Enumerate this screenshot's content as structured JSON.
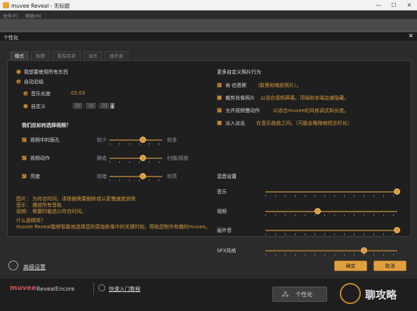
{
  "window": {
    "title": "muvee Reveal - 无标题",
    "min": "—",
    "max": "☐",
    "close": "✕"
  },
  "menu": [
    "文件(F)",
    "帮助(H)"
  ],
  "dialog": {
    "title": "个性化",
    "close": "✕"
  },
  "tabs": [
    "模式",
    "标题",
    "影院名单",
    "音乐",
    "画外音"
  ],
  "mode": {
    "option_random": "我想要使用所有东西",
    "option_auto": "自动总结",
    "music_length_label": "音乐长度",
    "music_length_value": "02:03",
    "custom_label": "自定义",
    "custom_h": "00",
    "custom_m": "00",
    "custom_s": "00",
    "sep1": ":",
    "sep2": ":"
  },
  "selection": {
    "heading": "我们应如何选择视频？",
    "rows": [
      {
        "label": "视频中的面孔",
        "left": "较少",
        "right": "较多",
        "level": 0.62
      },
      {
        "label": "视频动作",
        "left": "静态",
        "right": "扫描/摇放",
        "level": 0.62
      },
      {
        "label": "亮度",
        "left": "较暗",
        "right": "较亮",
        "level": 0.62
      }
    ]
  },
  "notes": {
    "lines": [
      [
        "图片：",
        "为符合时间，请根据需要删除或以更慢速度放映"
      ],
      [
        "音乐：",
        "播放所有音轨"
      ],
      [
        "视频：",
        "需要时截选以符合时间。"
      ]
    ],
    "what_title": "什么是精简？",
    "what_body": "muvee Reveal能够智能地选择您的原始影像中的关键时刻，帮助您制作有趣的muvee。"
  },
  "custom_photos": {
    "heading": "更多自定义照片行为",
    "items": [
      {
        "label": "肯·伯恩斯",
        "desc": "（取景和缩放照片）。"
      },
      {
        "label": "裁剪肖像照片",
        "desc": "以适合视频屏幕。顶端和末端会被隐藏。"
      },
      {
        "label": "允许视频慢动作",
        "desc": "以适合muvee的风格调式和长度。"
      },
      {
        "label": "淡入淡出",
        "desc": "在音乐曲曲之间。（可能会略微缩短总时长）"
      }
    ]
  },
  "mix": {
    "heading": "混音设置",
    "rows": [
      {
        "label": "音乐",
        "level": 1.0
      },
      {
        "label": "视频",
        "level": 0.4
      },
      {
        "label": "画外音",
        "level": 1.0
      },
      {
        "label": "SFX风格",
        "level": 0.75
      }
    ]
  },
  "footer": {
    "advanced": "高级设置",
    "ok": "确定",
    "cancel": "取消"
  },
  "bottom": {
    "brand1": "muvee",
    "brand2": "RevealEncore",
    "quickstart": "快速入门教程",
    "personalize": "个性化",
    "watermark": "聊攻略"
  }
}
